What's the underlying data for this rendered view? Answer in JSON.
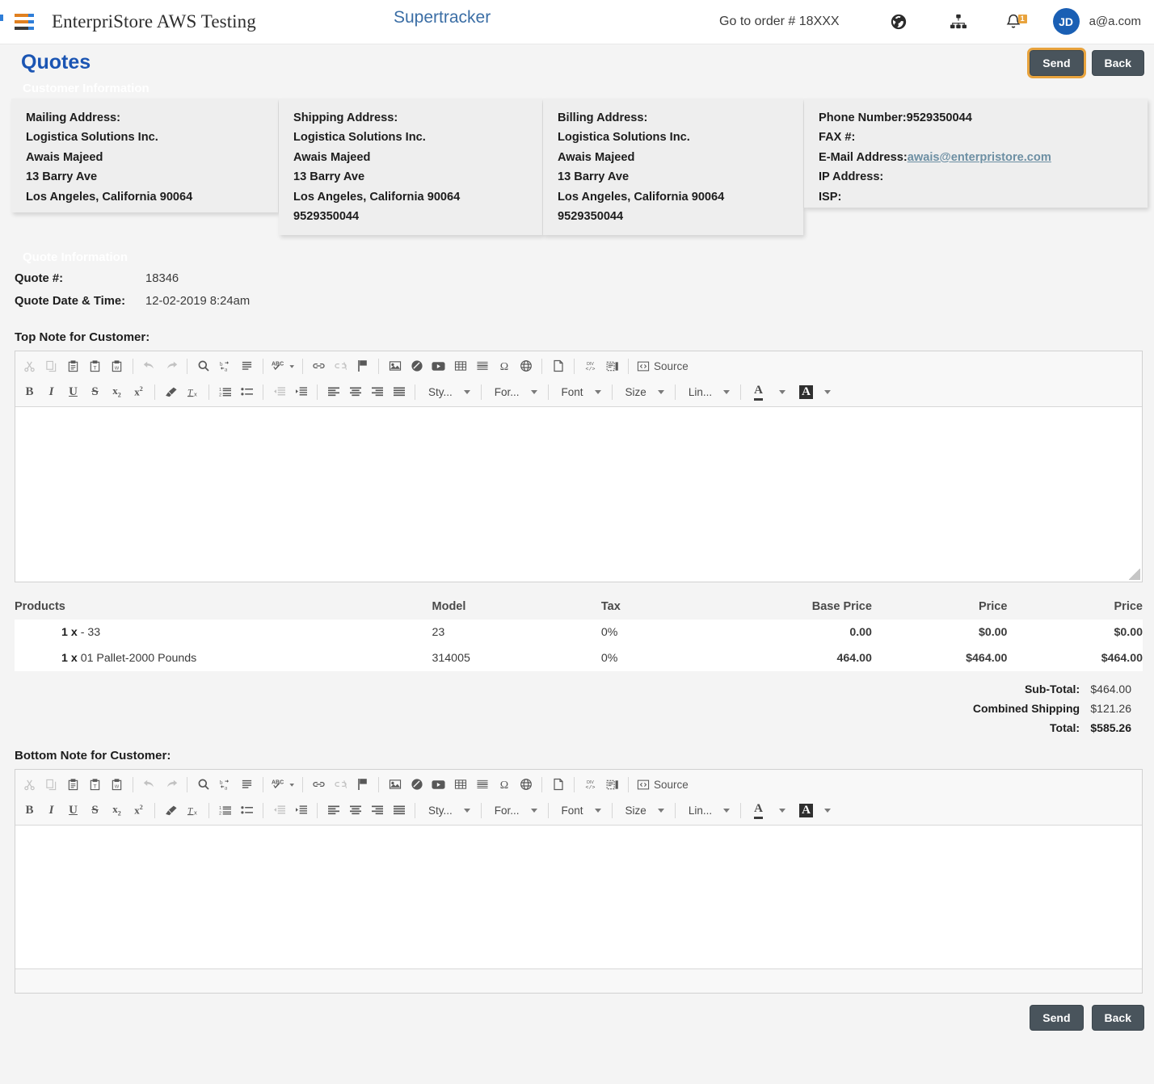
{
  "header": {
    "menu_icon": "hamburger-icon",
    "brand": "EnterpriStore AWS Testing",
    "app_label": "Supertracker",
    "goto_order": "Go to order # 18XXX",
    "icons": [
      "globe-icon",
      "sitemap-icon",
      "bell-icon"
    ],
    "notification_count": "1",
    "avatar_initials": "JD",
    "user_email": "a@a.com"
  },
  "page": {
    "title": "Quotes",
    "send_label": "Send",
    "back_label": "Back"
  },
  "customer_information": {
    "legend": "Customer Information",
    "mailing": {
      "label": "Mailing Address:",
      "company": "Logistica Solutions Inc.",
      "name": "Awais Majeed",
      "street": "13 Barry Ave",
      "citystate": "Los Angeles, California 90064"
    },
    "shipping": {
      "label": "Shipping Address:",
      "company": "Logistica Solutions Inc.",
      "name": "Awais Majeed",
      "street": "13 Barry Ave",
      "citystate": "Los Angeles, California 90064",
      "phone": "9529350044"
    },
    "billing": {
      "label": "Billing Address:",
      "company": "Logistica Solutions Inc.",
      "name": "Awais Majeed",
      "street": "13 Barry Ave",
      "citystate": "Los Angeles, California 90064",
      "phone": "9529350044"
    },
    "contact": {
      "phone_label": "Phone Number:",
      "phone_value": "9529350044",
      "fax_label": "FAX #:",
      "fax_value": "",
      "email_label": "E-Mail Address:",
      "email_value": "awais@enterpristore.com",
      "ip_label": "IP Address:",
      "ip_value": "",
      "isp_label": "ISP:",
      "isp_value": ""
    }
  },
  "quote_information": {
    "legend": "Quote Information",
    "quote_number_label": "Quote #:",
    "quote_number_value": "18346",
    "quote_date_label": "Quote Date & Time:",
    "quote_date_value": "12-02-2019 8:24am"
  },
  "top_note": {
    "label": "Top Note for Customer:",
    "content": ""
  },
  "bottom_note": {
    "label": "Bottom Note for Customer:",
    "content": ""
  },
  "editor_toolbar": {
    "source_label": "Source",
    "combos": [
      {
        "label": "Sty..."
      },
      {
        "label": "For..."
      },
      {
        "label": "Font"
      },
      {
        "label": "Size"
      },
      {
        "label": "Lin..."
      }
    ],
    "row1_icons": [
      "cut-icon",
      "copy-icon",
      "paste-icon",
      "paste-text-icon",
      "paste-word-icon",
      "undo-icon",
      "redo-icon",
      "find-icon",
      "replace-icon",
      "select-all-icon",
      "spellcheck-icon",
      "link-icon",
      "unlink-icon",
      "anchor-icon",
      "image-icon",
      "flash-icon",
      "youtube-icon",
      "table-icon",
      "horizontal-rule-icon",
      "special-char-icon",
      "iframe-icon",
      "page-break-icon",
      "div-container-icon",
      "show-blocks-icon",
      "source-icon"
    ],
    "row2_icons": [
      "bold-icon",
      "italic-icon",
      "underline-icon",
      "strikethrough-icon",
      "subscript-icon",
      "superscript-icon",
      "copy-formatting-icon",
      "remove-format-icon",
      "numbered-list-icon",
      "bulleted-list-icon",
      "outdent-icon",
      "indent-icon",
      "align-left-icon",
      "align-center-icon",
      "align-right-icon",
      "justify-icon",
      "text-color-icon",
      "background-color-icon"
    ]
  },
  "products": {
    "columns": [
      "Products",
      "Model",
      "Tax",
      "Base Price",
      "Price",
      "Price"
    ],
    "rows": [
      {
        "qty": "1 x",
        "name": "- 33",
        "model": "23",
        "tax": "0%",
        "base_price": "0.00",
        "price": "$0.00",
        "price2": "$0.00"
      },
      {
        "qty": "1 x",
        "name": "01 Pallet-2000 Pounds",
        "model": "314005",
        "tax": "0%",
        "base_price": "464.00",
        "price": "$464.00",
        "price2": "$464.00"
      }
    ],
    "totals": [
      {
        "label": "Sub-Total:",
        "value": "$464.00"
      },
      {
        "label": "Combined Shipping",
        "value": "$121.26"
      },
      {
        "label": "Total:",
        "value": "$585.26"
      }
    ]
  },
  "colors": {
    "accent_blue": "#1b55b3",
    "button_dark": "#49545c",
    "focus_gold": "#e8a33d",
    "avatar_blue": "#1a5fb4",
    "link": "#6d8fa3"
  }
}
